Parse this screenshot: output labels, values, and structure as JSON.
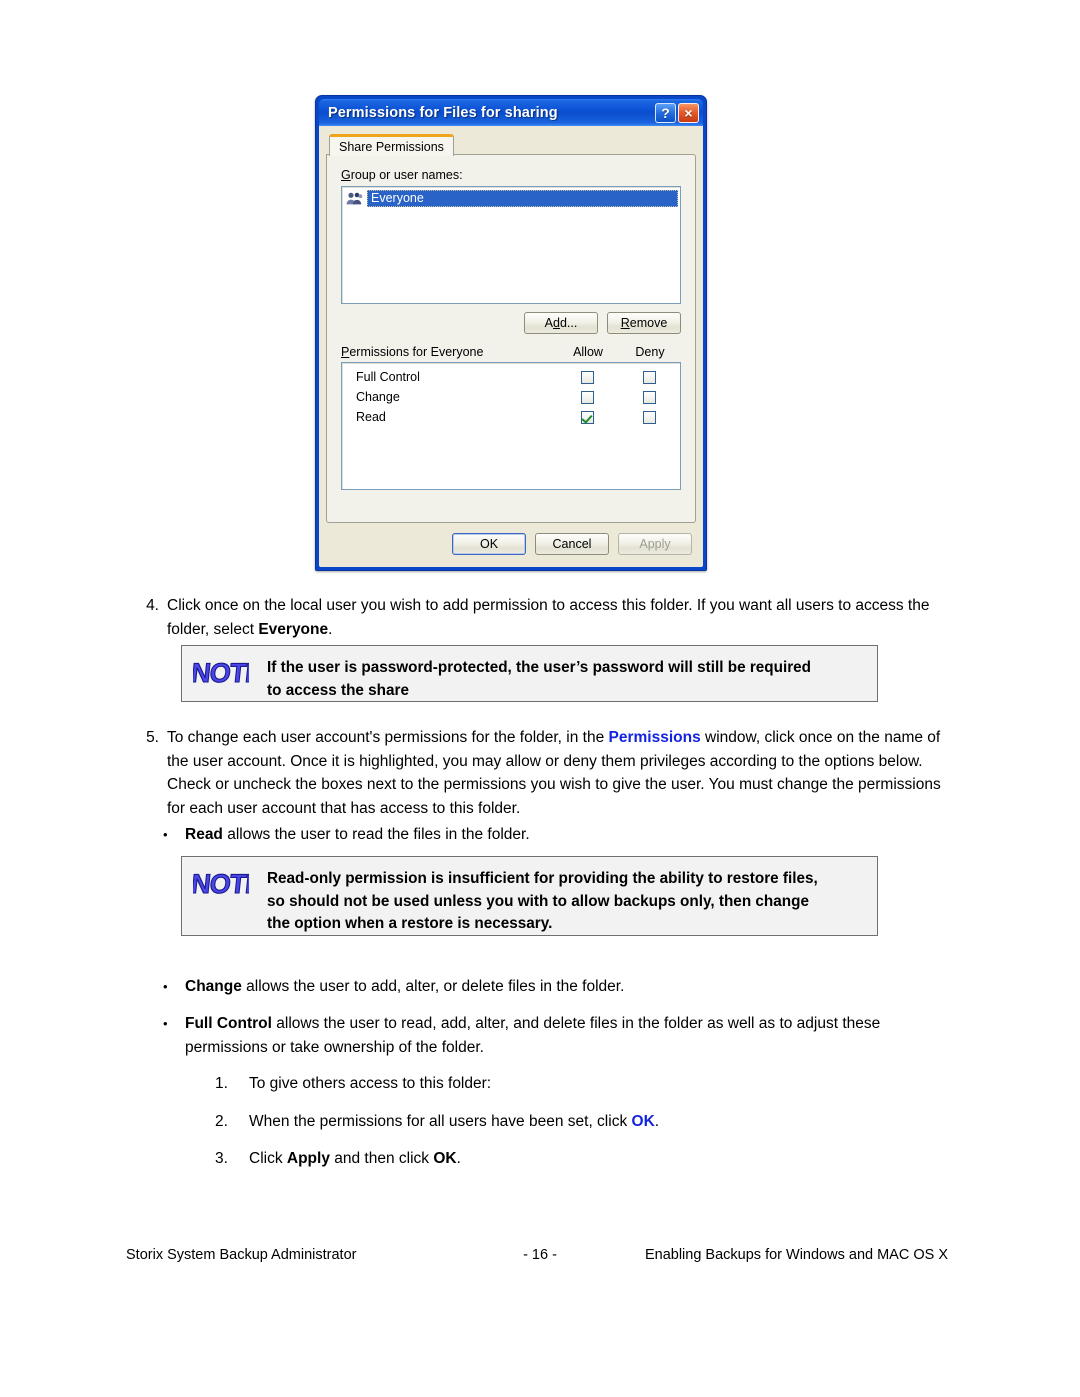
{
  "dialog": {
    "title": "Permissions for Files for sharing",
    "help_button": "?",
    "close_button": "×",
    "tab": "Share Permissions",
    "group_label_pre": "G",
    "group_label_post": "roup or user names:",
    "users": [
      {
        "name": "Everyone",
        "selected": true,
        "icon": "users-group-icon"
      }
    ],
    "add_button_pre": "A",
    "add_button_key": "d",
    "add_button_post": "d...",
    "remove_button_key": "R",
    "remove_button_post": "emove",
    "permissions_header": {
      "title_pre": "P",
      "title_post": "ermissions for Everyone",
      "allow": "Allow",
      "deny": "Deny"
    },
    "permissions": [
      {
        "name": "Full Control",
        "allow": false,
        "deny": false
      },
      {
        "name": "Change",
        "allow": false,
        "deny": false
      },
      {
        "name": "Read",
        "allow": true,
        "deny": false
      }
    ],
    "footer_buttons": {
      "ok": "OK",
      "cancel": "Cancel",
      "apply": "Apply",
      "apply_disabled": true
    },
    "colors": {
      "titlebar_blue": "#0c53d6",
      "selection_blue": "#2a63c8",
      "tab_accent_orange": "#f0a41d",
      "check_green": "#1f8a2e",
      "face": "#ece9d8"
    }
  },
  "doc": {
    "step4": {
      "num": "4.",
      "text_a": "Click once on the local user you wish to add permission to access this folder. If you want all users to access the folder, select ",
      "bold_b": "Everyone",
      "text_c": "."
    },
    "note1": {
      "icon": "NOTE",
      "line1": "If the user is password-protected, the user’s password will still be required",
      "line2": "to access the share"
    },
    "step5": {
      "num": "5.",
      "text_a": "To change each user account's permissions for the folder, in the ",
      "blue_b": "Permissions",
      "text_c": " window, click once on the name of the user account. Once it is highlighted, you may allow or deny them privileges according to the options below. Check or uncheck the boxes next to the permissions you wish to give the user. You must change the permissions for each user account that has access to this folder."
    },
    "bullet_read": {
      "dot": "•",
      "bold_a": "Read",
      "text_b": " allows the user to read the files in the folder."
    },
    "note2": {
      "icon": "NOTE",
      "line1": "Read-only permission is insufficient for providing the ability to restore files,",
      "line2": "so should not be used unless you with to allow backups only, then change",
      "line3": "the option when a restore is necessary."
    },
    "bullet_change": {
      "dot": "•",
      "bold_a": "Change",
      "text_b": " allows the user to add, alter, or delete files in the folder."
    },
    "bullet_full": {
      "dot": "•",
      "bold_a": "Full Control",
      "text_b": " allows the user to read, add, alter, and delete files in the folder as well as to adjust these permissions or take ownership of the folder."
    },
    "sub1": {
      "num": "1.",
      "text": "To give others access to this folder:"
    },
    "sub2": {
      "num": "2.",
      "text_a": "When the permissions for all users have been set, click ",
      "blue_b": "OK",
      "text_c": "."
    },
    "sub3": {
      "num": "3.",
      "text_a": "Click ",
      "bold_b": "Apply",
      "text_c": " and then click ",
      "bold_d": "OK",
      "text_e": "."
    },
    "accent_blue": "#1423e0"
  },
  "footer": {
    "left": "Storix System Backup Administrator",
    "center": "- 16 -",
    "right": "Enabling Backups for Windows and MAC OS X"
  }
}
